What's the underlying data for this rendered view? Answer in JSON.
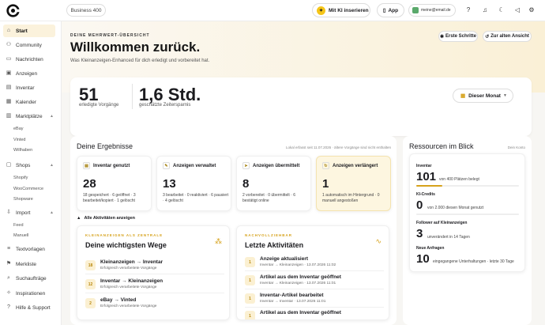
{
  "topbar": {
    "plan": "Business 400",
    "ki_button": "Mit KI inserieren",
    "app_button": "App",
    "email": "meine@email.de"
  },
  "sidebar": {
    "items": [
      {
        "label": "Start",
        "icon": "home-icon",
        "active": true
      },
      {
        "label": "Community",
        "icon": "users-icon"
      },
      {
        "label": "Nachrichten",
        "icon": "message-icon"
      },
      {
        "label": "Anzeigen",
        "icon": "ads-icon"
      },
      {
        "label": "Inventar",
        "icon": "box-icon"
      },
      {
        "label": "Kalender",
        "icon": "calendar-icon"
      },
      {
        "label": "Marktplätze",
        "icon": "store-icon",
        "expandable": true
      },
      {
        "label": "Shops",
        "icon": "shop-icon",
        "expandable": true
      },
      {
        "label": "Import",
        "icon": "import-icon",
        "expandable": true
      },
      {
        "label": "Textvorlagen",
        "icon": "text-icon"
      },
      {
        "label": "Merkliste",
        "icon": "bookmark-icon"
      },
      {
        "label": "Suchaufträge",
        "icon": "search-icon"
      },
      {
        "label": "Inspirationen",
        "icon": "bulb-icon"
      },
      {
        "label": "Hilfe & Support",
        "icon": "help-icon"
      }
    ],
    "marketplaces": [
      "eBay",
      "Vinted",
      "Willhaben"
    ],
    "shops": [
      "Shopify",
      "WooCommerce",
      "Shopware"
    ],
    "imports": [
      "Feed",
      "Manuell"
    ]
  },
  "hero": {
    "eyebrow": "DEINE MEHRWERT-ÜBERSICHT",
    "title": "Willkommen zurück.",
    "subtitle": "Was Kleinanzeigen-Enhanced für dich erledigt und vorbereitet hat.",
    "btn_first_steps": "Erste Schritte",
    "btn_old_view": "Zur alten Ansicht"
  },
  "stats": {
    "done_value": "51",
    "done_label": "erledigte Vorgänge",
    "time_value": "1,6 Std.",
    "time_label": "geschätzte Zeitersparnis",
    "period": "Dieser Monat"
  },
  "results": {
    "title": "Deine Ergebnisse",
    "meta": "Lokal erfasst seit 11.07.2026 · ältere Vorgänge sind nicht enthalten",
    "cards": [
      {
        "title": "Inventar genutzt",
        "icon": "box-icon",
        "value": "28",
        "desc": "18 gespeichert · 6 geöffnet · 3 bearbeitet/kopiert · 1 gelöscht"
      },
      {
        "title": "Anzeigen verwaltet",
        "icon": "edit-icon",
        "value": "13",
        "desc": "3 bearbeitet · 0 reaktiviert · 6 pausiert · 4 gelöscht"
      },
      {
        "title": "Anzeigen übermittelt",
        "icon": "send-icon",
        "value": "8",
        "desc": "2 vorbereitet · 0 übermittelt · 6 bestätigt online"
      },
      {
        "title": "Anzeigen verlängert",
        "icon": "refresh-icon",
        "value": "1",
        "desc": "1 automatisch im Hintergrund · 0 manuell angestoßen"
      }
    ],
    "toggle": "Alle Aktivitäten anzeigen"
  },
  "paths": {
    "eyebrow": "KLEINANZEIGEN ALS ZENTRALE",
    "title": "Deine wichtigsten Wege",
    "rows": [
      {
        "count": "18",
        "title": "Kleinanzeigen → Inventar",
        "sub": "Erfolgreich verarbeitete Vorgänge"
      },
      {
        "count": "12",
        "title": "Inventar → Kleinanzeigen",
        "sub": "Erfolgreich verarbeitete Vorgänge"
      },
      {
        "count": "2",
        "title": "eBay → Vinted",
        "sub": "Erfolgreich verarbeitete Vorgänge"
      }
    ]
  },
  "activities": {
    "eyebrow": "NACHVOLLZIEHBAR",
    "title": "Letzte Aktivitäten",
    "rows": [
      {
        "count": "1",
        "title": "Anzeige aktualisiert",
        "sub": "Inventar → Kleinanzeigen · 13.07.2026 11:02"
      },
      {
        "count": "1",
        "title": "Artikel aus dem Inventar geöffnet",
        "sub": "Inventar → Kleinanzeigen · 13.07.2026 11:01"
      },
      {
        "count": "1",
        "title": "Inventar-Artikel bearbeitet",
        "sub": "Inventar → Inventar · 13.07.2026 11:01"
      },
      {
        "count": "1",
        "title": "Artikel aus dem Inventar geöffnet",
        "sub": ""
      }
    ]
  },
  "resources": {
    "title": "Ressourcen im Blick",
    "account": "Dein Konto",
    "inventory_label": "Inventar",
    "inventory_value": "101",
    "inventory_desc": "von 400 Plätzen belegt",
    "inventory_fill": 0.25,
    "credits_label": "KI-Credits",
    "credits_value": "0",
    "credits_desc": "von 2.000 diesen Monat genutzt",
    "credits_fill": 0,
    "followers_label": "Follower auf Kleinanzeigen",
    "followers_value": "3",
    "followers_desc": "unverändert in 14 Tagen",
    "requests_label": "Neue Anfragen",
    "requests_value": "10",
    "requests_desc": "eingegangene Unterhaltungen · letzte 30 Tage"
  }
}
